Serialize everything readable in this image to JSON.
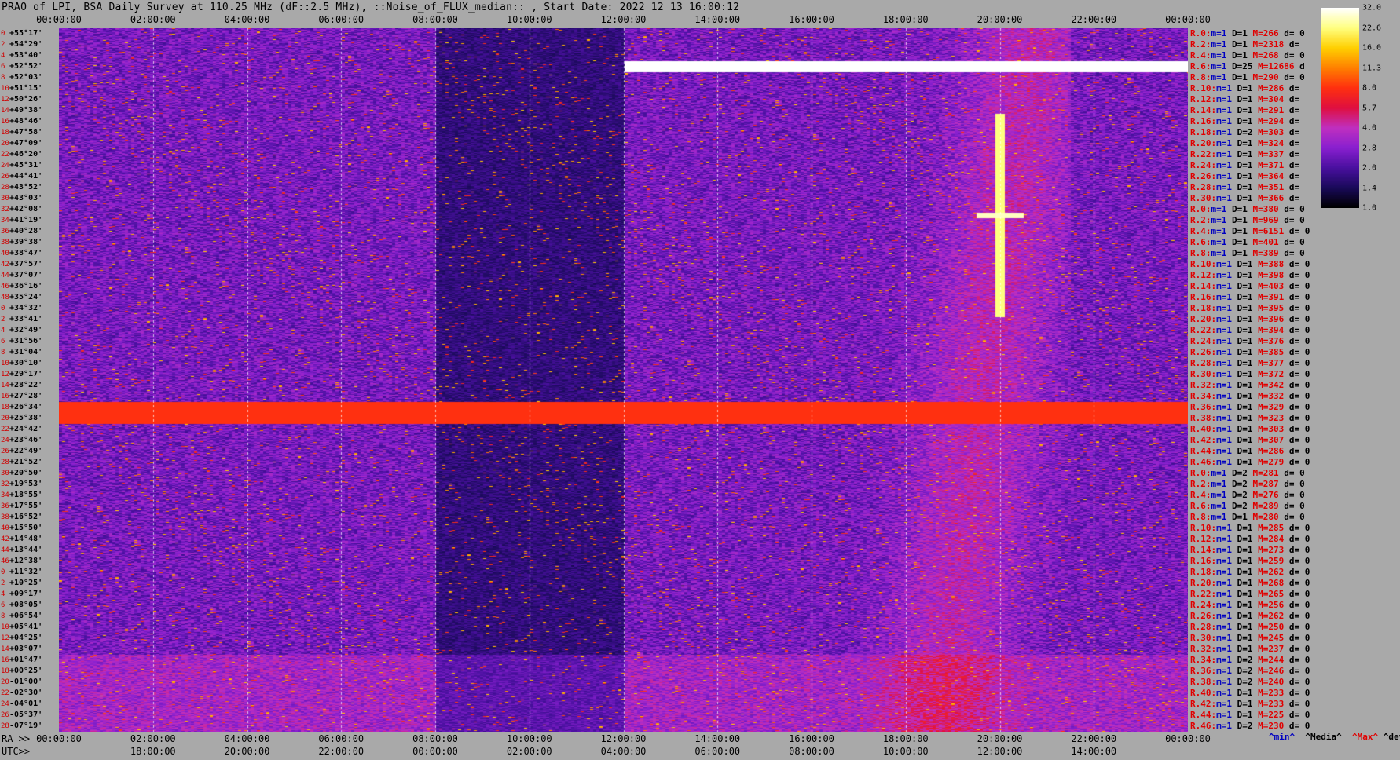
{
  "title": "PRAO of LPI, BSA Daily Survey at 110.25 MHz (dF::2.5 MHz), ::Noise_of_FLUX_median:: , Start Date: 2022 12 13 16:00:12",
  "chart_data": {
    "type": "heatmap",
    "top_axis_ticks": [
      "00:00:00",
      "02:00:00",
      "04:00:00",
      "06:00:00",
      "08:00:00",
      "10:00:00",
      "12:00:00",
      "14:00:00",
      "16:00:00",
      "18:00:00",
      "20:00:00",
      "22:00:00",
      "00:00:00"
    ],
    "ra_prefix": "RA >>",
    "ra_ticks": [
      "00:00:00",
      "02:00:00",
      "04:00:00",
      "06:00:00",
      "08:00:00",
      "10:00:00",
      "12:00:00",
      "14:00:00",
      "16:00:00",
      "18:00:00",
      "20:00:00",
      "22:00:00",
      "00:00:00"
    ],
    "utc_prefix": "UTC>>",
    "utc_ticks": [
      "18:00:00",
      "20:00:00",
      "22:00:00",
      "00:00:00",
      "02:00:00",
      "04:00:00",
      "06:00:00",
      "08:00:00",
      "10:00:00",
      "12:00:00",
      "14:00:00"
    ],
    "row_indices": [
      "0",
      "2",
      "4",
      "6",
      "8",
      "10",
      "12",
      "14",
      "16",
      "18",
      "20",
      "22",
      "24",
      "26",
      "28",
      "30",
      "32",
      "34",
      "36",
      "38",
      "40",
      "42",
      "44",
      "46",
      "48",
      "0",
      "2",
      "4",
      "6",
      "8",
      "10",
      "12",
      "14",
      "16",
      "18",
      "20",
      "22",
      "24",
      "26",
      "28",
      "30",
      "32",
      "34",
      "36",
      "38",
      "40",
      "42",
      "44",
      "46",
      "0",
      "2",
      "4",
      "6",
      "8",
      "10",
      "12",
      "14",
      "16",
      "18",
      "20",
      "22",
      "24",
      "26",
      "28",
      "30",
      "32",
      "34",
      "36",
      "38",
      "40",
      "42",
      "44",
      "46"
    ],
    "declinations": [
      "+55°17'",
      "+54°29'",
      "+53°40'",
      "+52°52'",
      "+52°03'",
      "+51°15'",
      "+50°26'",
      "+49°38'",
      "+48°46'",
      "+47°58'",
      "+47°09'",
      "+46°20'",
      "+45°31'",
      "+44°41'",
      "+43°52'",
      "+43°03'",
      "+42°08'",
      "+41°19'",
      "+40°28'",
      "+39°38'",
      "+38°47'",
      "+37°57'",
      "+37°07'",
      "+36°16'",
      "+35°24'",
      "+34°32'",
      "+33°41'",
      "+32°49'",
      "+31°56'",
      "+31°04'",
      "+30°10'",
      "+29°17'",
      "+28°22'",
      "+27°28'",
      "+26°34'",
      "+25°38'",
      "+24°42'",
      "+23°46'",
      "+22°49'",
      "+21°52'",
      "+20°50'",
      "+19°53'",
      "+18°55'",
      "+17°55'",
      "+16°52'",
      "+15°50'",
      "+14°48'",
      "+13°44'",
      "+12°38'",
      "+11°32'",
      "+10°25'",
      "+09°17'",
      "+08°05'",
      "+06°54'",
      "+05°41'",
      "+04°25'",
      "+03°07'",
      "+01°47'",
      "+00°25'",
      "-01°00'",
      "-02°30'",
      "-04°01'",
      "-05°37'",
      "-07°19'"
    ],
    "beam_stats": [
      {
        "r": "R.0:",
        "m": "m=1",
        "d": "D=1",
        "M": "M=266",
        "dev": "d= 0"
      },
      {
        "r": "R.2:",
        "m": "m=1",
        "d": "D=1",
        "M": "M=2318",
        "dev": "d="
      },
      {
        "r": "R.4:",
        "m": "m=1",
        "d": "D=1",
        "M": "M=268",
        "dev": "d= 0"
      },
      {
        "r": "R.6:",
        "m": "m=1",
        "d": "D=25",
        "M": "M=12686",
        "dev": "d"
      },
      {
        "r": "R.8:",
        "m": "m=1",
        "d": "D=1",
        "M": "M=290",
        "dev": "d= 0"
      },
      {
        "r": "R.10:",
        "m": "m=1",
        "d": "D=1",
        "M": "M=286",
        "dev": "d="
      },
      {
        "r": "R.12:",
        "m": "m=1",
        "d": "D=1",
        "M": "M=304",
        "dev": "d="
      },
      {
        "r": "R.14:",
        "m": "m=1",
        "d": "D=1",
        "M": "M=291",
        "dev": "d="
      },
      {
        "r": "R.16:",
        "m": "m=1",
        "d": "D=1",
        "M": "M=294",
        "dev": "d="
      },
      {
        "r": "R.18:",
        "m": "m=1",
        "d": "D=2",
        "M": "M=303",
        "dev": "d="
      },
      {
        "r": "R.20:",
        "m": "m=1",
        "d": "D=1",
        "M": "M=324",
        "dev": "d="
      },
      {
        "r": "R.22:",
        "m": "m=1",
        "d": "D=1",
        "M": "M=337",
        "dev": "d="
      },
      {
        "r": "R.24:",
        "m": "m=1",
        "d": "D=1",
        "M": "M=371",
        "dev": "d="
      },
      {
        "r": "R.26:",
        "m": "m=1",
        "d": "D=1",
        "M": "M=364",
        "dev": "d="
      },
      {
        "r": "R.28:",
        "m": "m=1",
        "d": "D=1",
        "M": "M=351",
        "dev": "d="
      },
      {
        "r": "R.30:",
        "m": "m=1",
        "d": "D=1",
        "M": "M=366",
        "dev": "d="
      },
      {
        "r": "R.0:",
        "m": "m=1",
        "d": "D=1",
        "M": "M=380",
        "dev": "d= 0"
      },
      {
        "r": "R.2:",
        "m": "m=1",
        "d": "D=1",
        "M": "M=969",
        "dev": "d= 0"
      },
      {
        "r": "R.4:",
        "m": "m=1",
        "d": "D=1",
        "M": "M=6151",
        "dev": "d= 0"
      },
      {
        "r": "R.6:",
        "m": "m=1",
        "d": "D=1",
        "M": "M=401",
        "dev": "d= 0"
      },
      {
        "r": "R.8:",
        "m": "m=1",
        "d": "D=1",
        "M": "M=389",
        "dev": "d= 0"
      },
      {
        "r": "R.10:",
        "m": "m=1",
        "d": "D=1",
        "M": "M=388",
        "dev": "d= 0"
      },
      {
        "r": "R.12:",
        "m": "m=1",
        "d": "D=1",
        "M": "M=398",
        "dev": "d= 0"
      },
      {
        "r": "R.14:",
        "m": "m=1",
        "d": "D=1",
        "M": "M=403",
        "dev": "d= 0"
      },
      {
        "r": "R.16:",
        "m": "m=1",
        "d": "D=1",
        "M": "M=391",
        "dev": "d= 0"
      },
      {
        "r": "R.18:",
        "m": "m=1",
        "d": "D=1",
        "M": "M=395",
        "dev": "d= 0"
      },
      {
        "r": "R.20:",
        "m": "m=1",
        "d": "D=1",
        "M": "M=396",
        "dev": "d= 0"
      },
      {
        "r": "R.22:",
        "m": "m=1",
        "d": "D=1",
        "M": "M=394",
        "dev": "d= 0"
      },
      {
        "r": "R.24:",
        "m": "m=1",
        "d": "D=1",
        "M": "M=376",
        "dev": "d= 0"
      },
      {
        "r": "R.26:",
        "m": "m=1",
        "d": "D=1",
        "M": "M=385",
        "dev": "d= 0"
      },
      {
        "r": "R.28:",
        "m": "m=1",
        "d": "D=1",
        "M": "M=377",
        "dev": "d= 0"
      },
      {
        "r": "R.30:",
        "m": "m=1",
        "d": "D=1",
        "M": "M=372",
        "dev": "d= 0"
      },
      {
        "r": "R.32:",
        "m": "m=1",
        "d": "D=1",
        "M": "M=342",
        "dev": "d= 0"
      },
      {
        "r": "R.34:",
        "m": "m=1",
        "d": "D=1",
        "M": "M=332",
        "dev": "d= 0"
      },
      {
        "r": "R.36:",
        "m": "m=1",
        "d": "D=1",
        "M": "M=329",
        "dev": "d= 0"
      },
      {
        "r": "R.38:",
        "m": "m=1",
        "d": "D=1",
        "M": "M=323",
        "dev": "d= 0"
      },
      {
        "r": "R.40:",
        "m": "m=1",
        "d": "D=1",
        "M": "M=303",
        "dev": "d= 0"
      },
      {
        "r": "R.42:",
        "m": "m=1",
        "d": "D=1",
        "M": "M=307",
        "dev": "d= 0"
      },
      {
        "r": "R.44:",
        "m": "m=1",
        "d": "D=1",
        "M": "M=286",
        "dev": "d= 0"
      },
      {
        "r": "R.46:",
        "m": "m=1",
        "d": "D=1",
        "M": "M=279",
        "dev": "d= 0"
      },
      {
        "r": "R.0:",
        "m": "m=1",
        "d": "D=2",
        "M": "M=281",
        "dev": "d= 0"
      },
      {
        "r": "R.2:",
        "m": "m=1",
        "d": "D=2",
        "M": "M=287",
        "dev": "d= 0"
      },
      {
        "r": "R.4:",
        "m": "m=1",
        "d": "D=2",
        "M": "M=276",
        "dev": "d= 0"
      },
      {
        "r": "R.6:",
        "m": "m=1",
        "d": "D=2",
        "M": "M=289",
        "dev": "d= 0"
      },
      {
        "r": "R.8:",
        "m": "m=1",
        "d": "D=1",
        "M": "M=280",
        "dev": "d= 0"
      },
      {
        "r": "R.10:",
        "m": "m=1",
        "d": "D=1",
        "M": "M=285",
        "dev": "d= 0"
      },
      {
        "r": "R.12:",
        "m": "m=1",
        "d": "D=1",
        "M": "M=284",
        "dev": "d= 0"
      },
      {
        "r": "R.14:",
        "m": "m=1",
        "d": "D=1",
        "M": "M=273",
        "dev": "d= 0"
      },
      {
        "r": "R.16:",
        "m": "m=1",
        "d": "D=1",
        "M": "M=259",
        "dev": "d= 0"
      },
      {
        "r": "R.18:",
        "m": "m=1",
        "d": "D=1",
        "M": "M=262",
        "dev": "d= 0"
      },
      {
        "r": "R.20:",
        "m": "m=1",
        "d": "D=1",
        "M": "M=268",
        "dev": "d= 0"
      },
      {
        "r": "R.22:",
        "m": "m=1",
        "d": "D=1",
        "M": "M=265",
        "dev": "d= 0"
      },
      {
        "r": "R.24:",
        "m": "m=1",
        "d": "D=1",
        "M": "M=256",
        "dev": "d= 0"
      },
      {
        "r": "R.26:",
        "m": "m=1",
        "d": "D=1",
        "M": "M=262",
        "dev": "d= 0"
      },
      {
        "r": "R.28:",
        "m": "m=1",
        "d": "D=1",
        "M": "M=250",
        "dev": "d= 0"
      },
      {
        "r": "R.30:",
        "m": "m=1",
        "d": "D=1",
        "M": "M=245",
        "dev": "d= 0"
      },
      {
        "r": "R.32:",
        "m": "m=1",
        "d": "D=1",
        "M": "M=237",
        "dev": "d= 0"
      },
      {
        "r": "R.34:",
        "m": "m=1",
        "d": "D=2",
        "M": "M=244",
        "dev": "d= 0"
      },
      {
        "r": "R.36:",
        "m": "m=1",
        "d": "D=2",
        "M": "M=246",
        "dev": "d= 0"
      },
      {
        "r": "R.38:",
        "m": "m=1",
        "d": "D=2",
        "M": "M=240",
        "dev": "d= 0"
      },
      {
        "r": "R.40:",
        "m": "m=1",
        "d": "D=1",
        "M": "M=233",
        "dev": "d= 0"
      },
      {
        "r": "R.42:",
        "m": "m=1",
        "d": "D=1",
        "M": "M=233",
        "dev": "d= 0"
      },
      {
        "r": "R.44:",
        "m": "m=1",
        "d": "D=1",
        "M": "M=225",
        "dev": "d= 0"
      },
      {
        "r": "R.46:",
        "m": "m=1",
        "d": "D=2",
        "M": "M=230",
        "dev": "d= 0"
      }
    ],
    "stat_legend": {
      "min": "^min^",
      "median": "^Media^",
      "max": "^Max^",
      "dev": "^devia^"
    },
    "colorbar_ticks": [
      "32.0",
      "22.6",
      "16.0",
      "11.3",
      "8.0",
      "5.7",
      "4.0",
      "2.8",
      "2.0",
      "1.4",
      "1.0"
    ],
    "colorbar_scale": "log",
    "colormap": [
      "#000000",
      "#1a0a5a",
      "#4a10a0",
      "#8a20d0",
      "#c030c0",
      "#e01040",
      "#ff3010",
      "#ff8000",
      "#ffd000",
      "#ffff80",
      "#ffffff"
    ],
    "features": {
      "white_horizontal_bands_dec": [
        "+52°52'"
      ],
      "red_horizontal_bands_dec": [
        "+26°34'",
        "+25°38'"
      ],
      "bright_source_ra": "20:00:00",
      "bright_source_dec": "+41°19'",
      "diffuse_band_ra_range": [
        "17:00:00",
        "20:30:00"
      ]
    }
  }
}
